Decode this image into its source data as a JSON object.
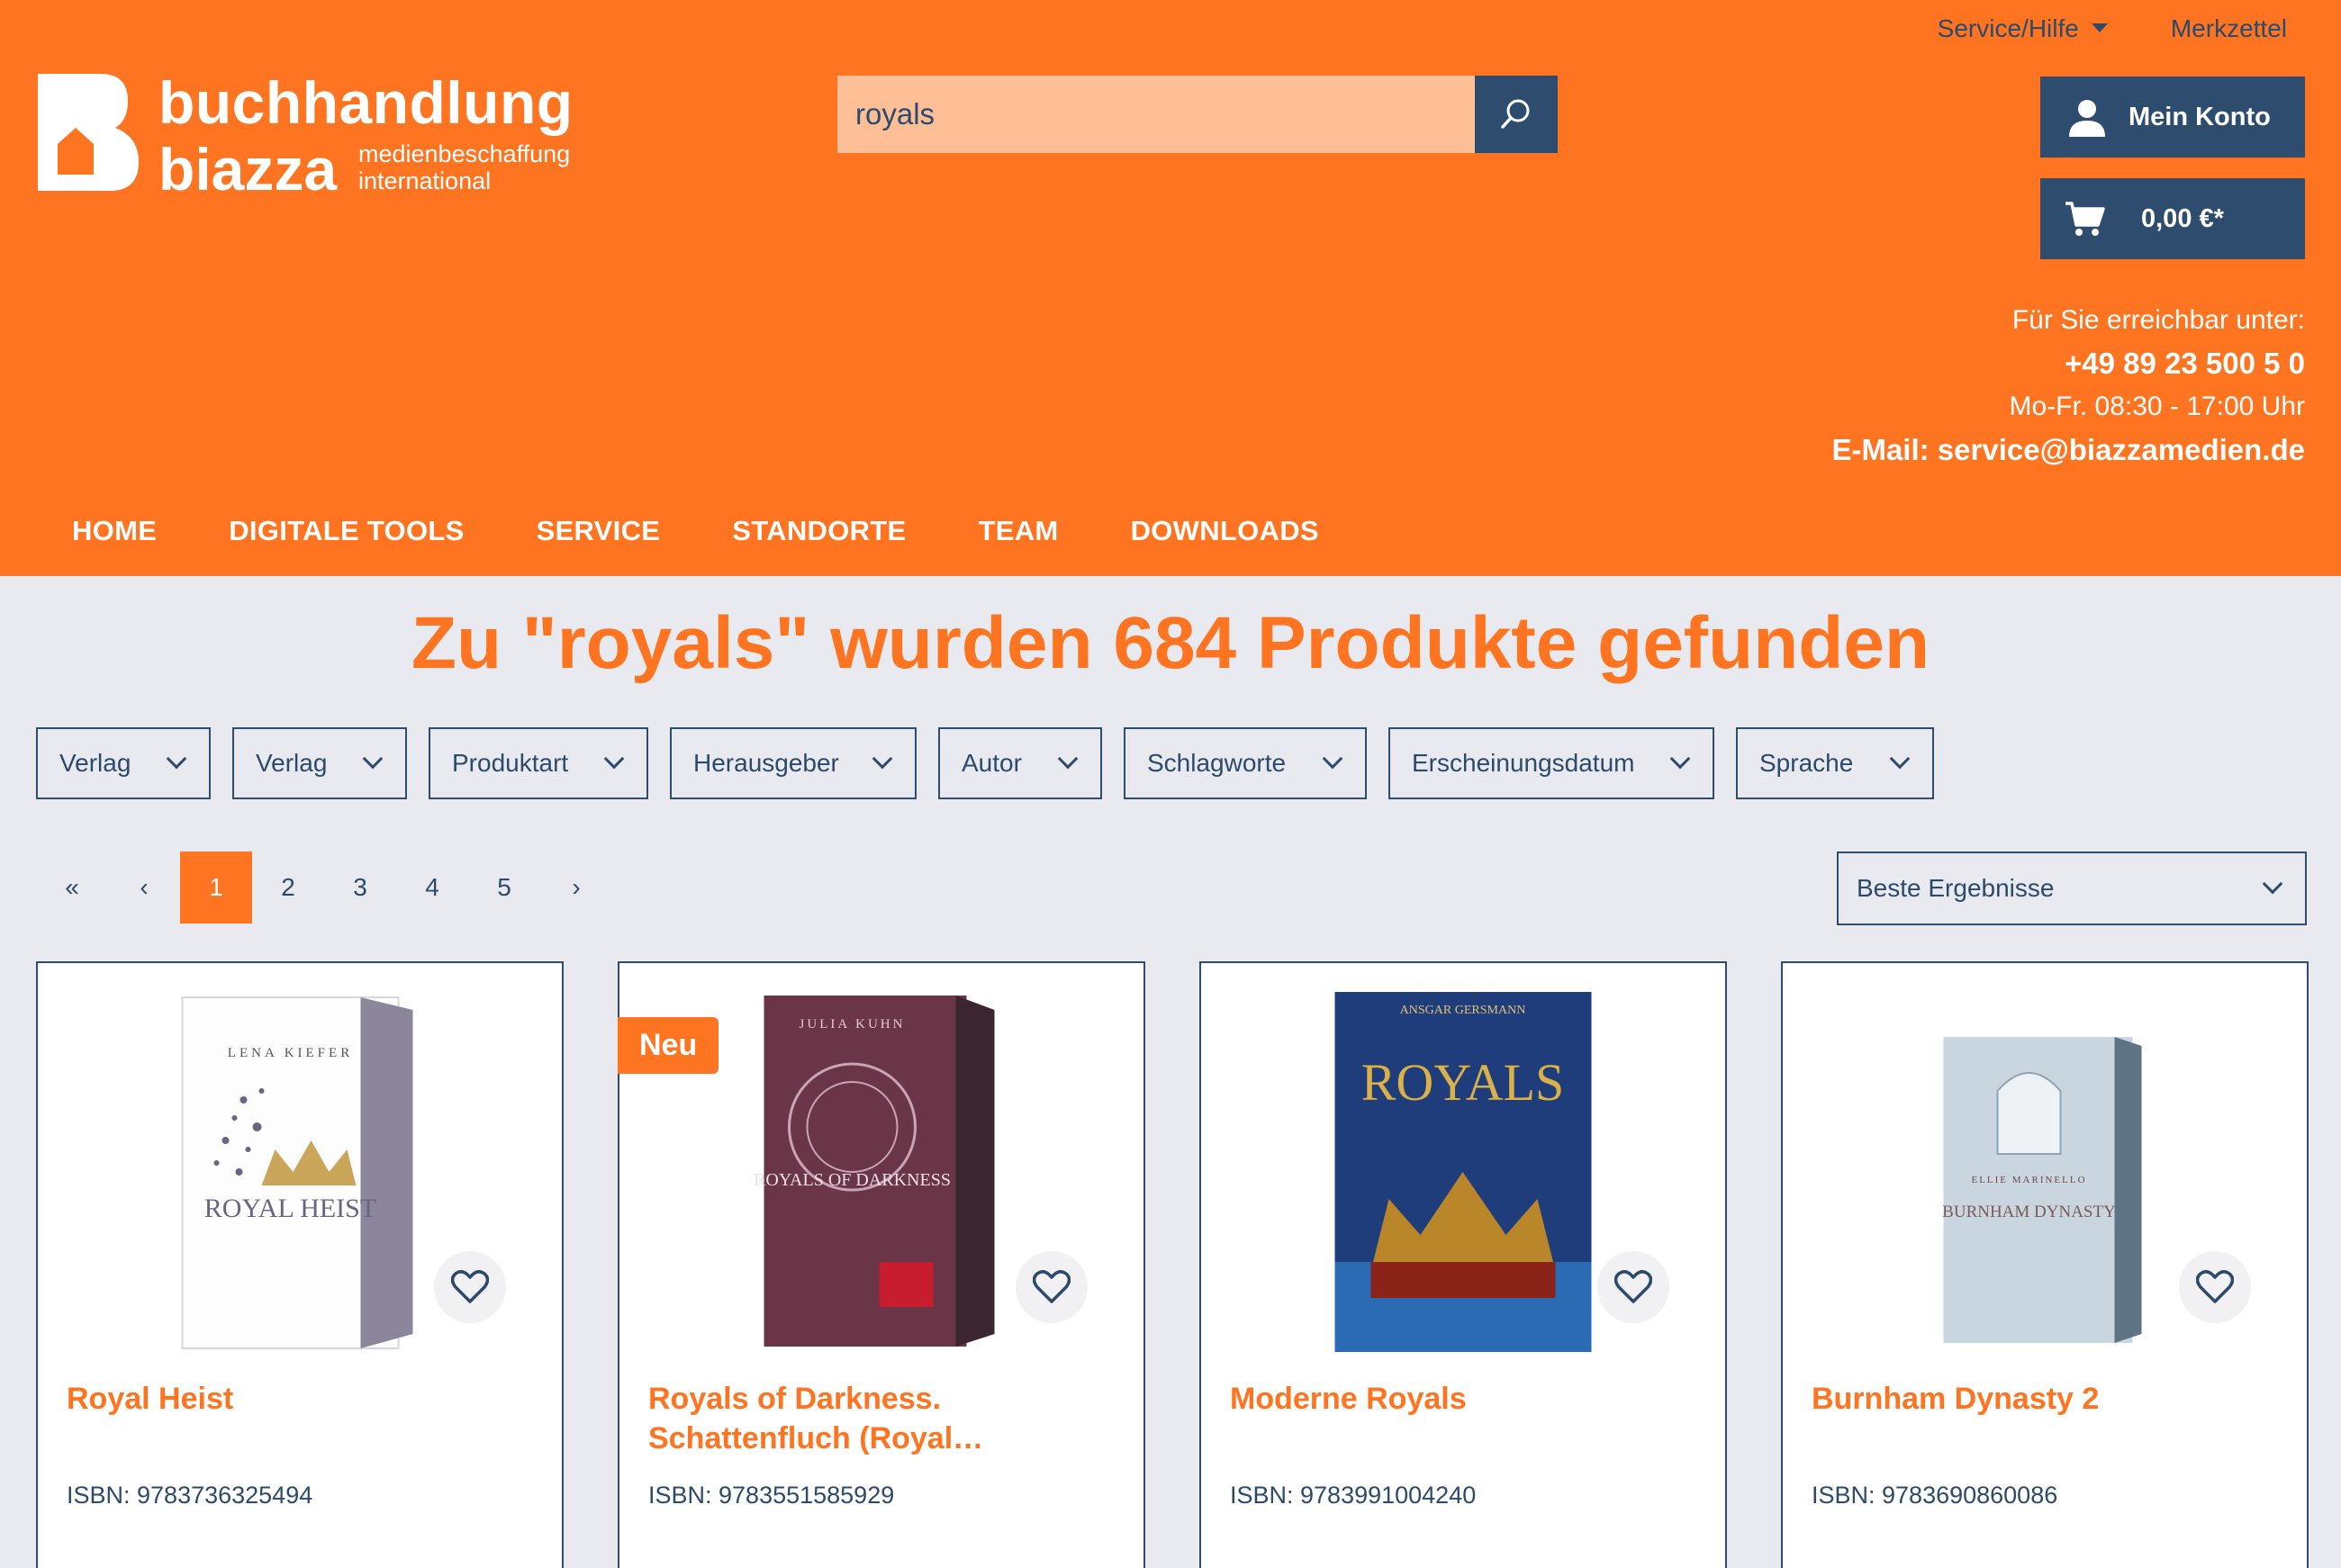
{
  "topbar": {
    "service": "Service/Hilfe",
    "wishlist": "Merkzettel"
  },
  "logo": {
    "word1": "buchhandlung",
    "word2": "biazza",
    "sub1": "medienbeschaffung",
    "sub2": "international"
  },
  "search": {
    "value": "royals"
  },
  "account": {
    "label": "Mein Konto"
  },
  "cart": {
    "label": "0,00 €*"
  },
  "contact": {
    "intro": "Für Sie erreichbar unter:",
    "phone": "+49 89 23 500 5 0",
    "hours": "Mo-Fr. 08:30 - 17:00 Uhr",
    "email": "E-Mail: service@biazzamedien.de"
  },
  "nav": [
    "HOME",
    "DIGITALE TOOLS",
    "SERVICE",
    "STANDORTE",
    "TEAM",
    "DOWNLOADS"
  ],
  "results": {
    "title": "Zu \"royals\" wurden 684 Produkte gefunden"
  },
  "filters": [
    "Verlag",
    "Verlag",
    "Produktart",
    "Herausgeber",
    "Autor",
    "Schlagworte",
    "Erscheinungsdatum",
    "Sprache"
  ],
  "pager": {
    "first": "«",
    "prev": "‹",
    "pages": [
      "1",
      "2",
      "3",
      "4",
      "5"
    ],
    "active": "1",
    "next": "›"
  },
  "sort": {
    "selected": "Beste Ergebnisse"
  },
  "products": [
    {
      "title": "Royal Heist",
      "isbn": "ISBN: 9783736325494",
      "badge": "",
      "cover_author": "LENA KIEFER",
      "cover_title": "ROYAL HEIST"
    },
    {
      "title": "Royals of Darkness. Schattenfluch (Royal…",
      "isbn": "ISBN: 9783551585929",
      "badge": "Neu",
      "cover_author": "JULIA KUHN",
      "cover_title": "ROYALS OF DARKNESS"
    },
    {
      "title": "Moderne Royals",
      "isbn": "ISBN: 9783991004240",
      "badge": "",
      "cover_author": "ANSGAR GERSMANN",
      "cover_title": "ROYALS"
    },
    {
      "title": "Burnham Dynasty 2",
      "isbn": "ISBN: 9783690860086",
      "badge": "",
      "cover_author": "ELLIE MARINELLO",
      "cover_title": "BURNHAM DYNASTY"
    }
  ],
  "colors": {
    "brand_orange": "#ff7420",
    "navy": "#2e4d6e",
    "search_bg": "#ffbf96",
    "page_bg": "#e9eaef"
  }
}
